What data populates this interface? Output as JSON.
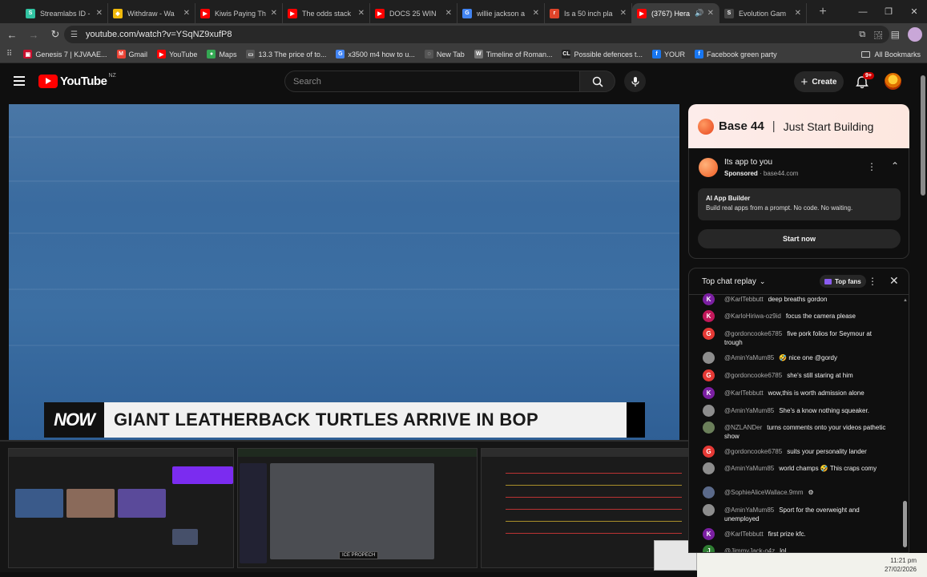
{
  "browser": {
    "tabs": [
      {
        "title": "Streamlabs ID -",
        "fav_color": "#31c3a2",
        "fav_glyph": "S"
      },
      {
        "title": "Withdraw - Wa",
        "fav_color": "#f0b90b",
        "fav_glyph": "◆"
      },
      {
        "title": "Kiwis Paying Th",
        "fav_color": "#ff0000",
        "fav_glyph": "▶"
      },
      {
        "title": "The odds stack",
        "fav_color": "#ff0000",
        "fav_glyph": "▶"
      },
      {
        "title": "DOCS 25 WIN",
        "fav_color": "#ff0000",
        "fav_glyph": "▶"
      },
      {
        "title": "willie jackson a",
        "fav_color": "#4285f4",
        "fav_glyph": "G"
      },
      {
        "title": "Is a 50 inch pla",
        "fav_color": "#e0442a",
        "fav_glyph": "r"
      },
      {
        "title": "(3767) Hera",
        "fav_color": "#ff0000",
        "fav_glyph": "▶",
        "active": true
      },
      {
        "title": "Evolution Gam",
        "fav_color": "#444444",
        "fav_glyph": "S"
      }
    ],
    "url": "youtube.com/watch?v=YSqNZ9xufP8",
    "bookmarks": [
      {
        "label": "Genesis 7 | KJVAAE...",
        "color": "#c8102e",
        "glyph": "▣"
      },
      {
        "label": "Gmail",
        "color": "#ea4335",
        "glyph": "M"
      },
      {
        "label": "YouTube",
        "color": "#ff0000",
        "glyph": "▶"
      },
      {
        "label": "Maps",
        "color": "#34a853",
        "glyph": "●"
      },
      {
        "label": "13.3 The price of to...",
        "color": "#555555",
        "glyph": "▭"
      },
      {
        "label": "x3500 m4 how to u...",
        "color": "#4285f4",
        "glyph": "G"
      },
      {
        "label": "New Tab",
        "color": "#555555",
        "glyph": "◌"
      },
      {
        "label": "Timeline of Roman...",
        "color": "#777777",
        "glyph": "W"
      },
      {
        "label": "Possible defences t...",
        "color": "#222222",
        "glyph": "CL"
      },
      {
        "label": "YOUR",
        "color": "#1877f2",
        "glyph": "f"
      },
      {
        "label": "Facebook green party",
        "color": "#1877f2",
        "glyph": "f"
      }
    ],
    "all_bookmarks": "All Bookmarks"
  },
  "youtube": {
    "logo_text": "YouTube",
    "country": "NZ",
    "search_placeholder": "Search",
    "create_label": "Create",
    "notifications": "9+"
  },
  "video": {
    "now_label": "NOW",
    "headline": "GIANT LEATHERBACK TURTLES ARRIVE IN BOP"
  },
  "ad": {
    "brand": "Base 44",
    "tagline": "Just Start Building",
    "title": "Its app to you",
    "sponsored": "Sponsored",
    "domain": "base44.com",
    "card_heading": "AI App Builder",
    "card_desc": "Build real apps from a prompt. No code. No waiting.",
    "cta": "Start now"
  },
  "chat": {
    "title": "Top chat replay",
    "top_fans": "Top fans",
    "messages": [
      {
        "initial": "K",
        "color": "#7b1fa2",
        "author": "@KarlTebbutt",
        "text": "deep breaths gordon"
      },
      {
        "initial": "K",
        "color": "#c2185b",
        "author": "@KarloHiriwa-oz9id",
        "text": "focus the camera please"
      },
      {
        "initial": "G",
        "color": "#e53935",
        "author": "@gordoncooke6785",
        "text": "five pork folios for Seymour at trough"
      },
      {
        "initial": "",
        "color": "#8d8d8d",
        "author": "@AminYaMum85",
        "text": "🤣 nice one @gordy"
      },
      {
        "initial": "G",
        "color": "#e53935",
        "author": "@gordoncooke6785",
        "text": "she's still staring at him"
      },
      {
        "initial": "K",
        "color": "#7b1fa2",
        "author": "@KarlTebbutt",
        "text": "wow,this is worth admission alone"
      },
      {
        "initial": "",
        "color": "#8d8d8d",
        "author": "@AminYaMum85",
        "text": "She's a know nothing squeaker."
      },
      {
        "initial": "",
        "color": "#6b7f5a",
        "author": "@NZLANDer",
        "text": "turns comments onto your videos pathetic show"
      },
      {
        "initial": "G",
        "color": "#e53935",
        "author": "@gordoncooke6785",
        "text": "suits your personality lander"
      },
      {
        "initial": "",
        "color": "#8d8d8d",
        "author": "@AminYaMum85",
        "text": "world champs 🤣 This craps comy"
      },
      {
        "initial": "",
        "color": "#5b6a8a",
        "author": "@SophieAliceWallace.9mm",
        "text": "⚙"
      },
      {
        "initial": "",
        "color": "#8d8d8d",
        "author": "@AminYaMum85",
        "text": "Sport for the overweight and unemployed"
      },
      {
        "initial": "K",
        "color": "#7b1fa2",
        "author": "@KarlTebbutt",
        "text": "first prize kfc."
      },
      {
        "initial": "J",
        "color": "#2e7d32",
        "author": "@JimmyJack-o4z",
        "text": "lol...."
      }
    ]
  },
  "taskbar": {
    "time": "11:21 pm",
    "date": "27/02/2026",
    "thumb_badge": "ICE PROPECH"
  },
  "colors": {
    "yt_red": "#ff0000",
    "bg": "#0f0f0f",
    "accent_purple": "#8a5cf0"
  }
}
